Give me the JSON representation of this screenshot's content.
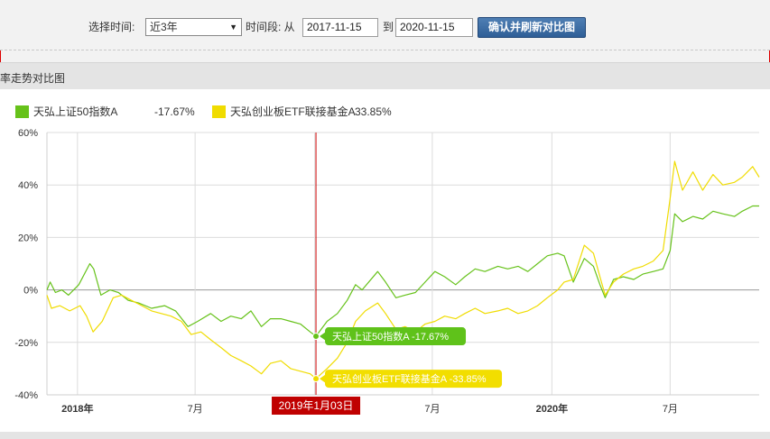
{
  "toolbar": {
    "period_label": "选择时间:",
    "period_value": "近3年",
    "range_label": "时间段: 从",
    "start_date": "2017-11-15",
    "to_label": "到",
    "end_date": "2020-11-15",
    "confirm_button": "确认并刷新对比图"
  },
  "section": {
    "title": "率走势对比图"
  },
  "colors": {
    "series_a": "#66c21a",
    "series_b": "#f0dc00",
    "crosshair": "#cc0000",
    "date_badge": "#c00000"
  },
  "legend": [
    {
      "name": "天弘上证50指数A",
      "value": "-17.67%"
    },
    {
      "name": "天弘创业板ETF联接基金A",
      "value": "-33.85%"
    }
  ],
  "tooltip": {
    "date": "2019年1月03日",
    "series_a": "天弘上证50指数A -17.67%",
    "series_b": "天弘创业板ETF联接基金A -33.85%"
  },
  "chart_data": {
    "type": "line",
    "title": "",
    "xlabel": "",
    "ylabel": "",
    "y_unit": "%",
    "ylim": [
      -40,
      60
    ],
    "y_ticks": [
      -40,
      -20,
      0,
      20,
      40,
      60
    ],
    "y_tick_labels": [
      "-40%",
      "-20%",
      "0%",
      "20%",
      "40%",
      "60%"
    ],
    "x_range": [
      "2017-11-15",
      "2020-11-15"
    ],
    "x_ticks": [
      {
        "date": "2018-01-01",
        "label": "2018年",
        "bold": true
      },
      {
        "date": "2018-07-01",
        "label": "7月",
        "bold": false
      },
      {
        "date": "2019-01-01",
        "label": "",
        "bold": false
      },
      {
        "date": "2019-07-01",
        "label": "7月",
        "bold": false
      },
      {
        "date": "2020-01-01",
        "label": "2020年",
        "bold": true
      },
      {
        "date": "2020-07-01",
        "label": "7月",
        "bold": false
      }
    ],
    "grid": true,
    "legend_position": "top-left",
    "crosshair_date": "2019-01-03",
    "series": [
      {
        "name": "天弘上证50指数A",
        "color": "#66c21a",
        "points": [
          [
            "2017-11-15",
            0
          ],
          [
            "2017-11-20",
            3
          ],
          [
            "2017-11-28",
            -1
          ],
          [
            "2017-12-08",
            0
          ],
          [
            "2017-12-18",
            -2
          ],
          [
            "2018-01-03",
            2
          ],
          [
            "2018-01-20",
            10
          ],
          [
            "2018-01-26",
            8
          ],
          [
            "2018-02-06",
            -2
          ],
          [
            "2018-02-20",
            0
          ],
          [
            "2018-03-05",
            -1
          ],
          [
            "2018-03-20",
            -4
          ],
          [
            "2018-04-05",
            -5
          ],
          [
            "2018-04-25",
            -7
          ],
          [
            "2018-05-15",
            -6
          ],
          [
            "2018-06-01",
            -8
          ],
          [
            "2018-06-20",
            -14
          ],
          [
            "2018-07-05",
            -12
          ],
          [
            "2018-07-25",
            -9
          ],
          [
            "2018-08-10",
            -12
          ],
          [
            "2018-08-25",
            -10
          ],
          [
            "2018-09-10",
            -11
          ],
          [
            "2018-09-25",
            -8
          ],
          [
            "2018-10-11",
            -14
          ],
          [
            "2018-10-25",
            -11
          ],
          [
            "2018-11-10",
            -11
          ],
          [
            "2018-11-25",
            -12
          ],
          [
            "2018-12-10",
            -13
          ],
          [
            "2018-12-25",
            -16
          ],
          [
            "2019-01-03",
            -17.67
          ],
          [
            "2019-01-20",
            -12
          ],
          [
            "2019-02-05",
            -9
          ],
          [
            "2019-02-20",
            -4
          ],
          [
            "2019-03-05",
            2
          ],
          [
            "2019-03-15",
            0
          ],
          [
            "2019-04-08",
            7
          ],
          [
            "2019-04-20",
            3
          ],
          [
            "2019-05-06",
            -3
          ],
          [
            "2019-05-20",
            -2
          ],
          [
            "2019-06-05",
            -1
          ],
          [
            "2019-06-20",
            3
          ],
          [
            "2019-07-05",
            7
          ],
          [
            "2019-07-20",
            5
          ],
          [
            "2019-08-06",
            2
          ],
          [
            "2019-08-20",
            5
          ],
          [
            "2019-09-05",
            8
          ],
          [
            "2019-09-20",
            7
          ],
          [
            "2019-10-10",
            9
          ],
          [
            "2019-10-25",
            8
          ],
          [
            "2019-11-10",
            9
          ],
          [
            "2019-11-25",
            7
          ],
          [
            "2019-12-10",
            10
          ],
          [
            "2019-12-25",
            13
          ],
          [
            "2020-01-10",
            14
          ],
          [
            "2020-01-20",
            13
          ],
          [
            "2020-02-03",
            3
          ],
          [
            "2020-02-20",
            12
          ],
          [
            "2020-03-05",
            9
          ],
          [
            "2020-03-15",
            2
          ],
          [
            "2020-03-23",
            -3
          ],
          [
            "2020-04-05",
            4
          ],
          [
            "2020-04-20",
            5
          ],
          [
            "2020-05-06",
            4
          ],
          [
            "2020-05-20",
            6
          ],
          [
            "2020-06-05",
            7
          ],
          [
            "2020-06-20",
            8
          ],
          [
            "2020-07-01",
            15
          ],
          [
            "2020-07-08",
            29
          ],
          [
            "2020-07-20",
            26
          ],
          [
            "2020-08-05",
            28
          ],
          [
            "2020-08-20",
            27
          ],
          [
            "2020-09-05",
            30
          ],
          [
            "2020-09-20",
            29
          ],
          [
            "2020-10-08",
            28
          ],
          [
            "2020-10-20",
            30
          ],
          [
            "2020-11-05",
            32
          ],
          [
            "2020-11-15",
            32
          ]
        ]
      },
      {
        "name": "天弘创业板ETF联接基金A",
        "color": "#f0dc00",
        "points": [
          [
            "2017-11-15",
            -2
          ],
          [
            "2017-11-22",
            -7
          ],
          [
            "2017-12-05",
            -6
          ],
          [
            "2017-12-20",
            -8
          ],
          [
            "2018-01-05",
            -6
          ],
          [
            "2018-01-15",
            -10
          ],
          [
            "2018-01-25",
            -16
          ],
          [
            "2018-02-08",
            -12
          ],
          [
            "2018-02-25",
            -3
          ],
          [
            "2018-03-10",
            -2
          ],
          [
            "2018-03-25",
            -4
          ],
          [
            "2018-04-10",
            -6
          ],
          [
            "2018-04-25",
            -8
          ],
          [
            "2018-05-10",
            -9
          ],
          [
            "2018-05-25",
            -10
          ],
          [
            "2018-06-10",
            -12
          ],
          [
            "2018-06-25",
            -17
          ],
          [
            "2018-07-10",
            -16
          ],
          [
            "2018-07-25",
            -19
          ],
          [
            "2018-08-10",
            -22
          ],
          [
            "2018-08-25",
            -25
          ],
          [
            "2018-09-10",
            -27
          ],
          [
            "2018-09-25",
            -29
          ],
          [
            "2018-10-11",
            -32
          ],
          [
            "2018-10-25",
            -28
          ],
          [
            "2018-11-10",
            -27
          ],
          [
            "2018-11-25",
            -30
          ],
          [
            "2018-12-10",
            -31
          ],
          [
            "2018-12-25",
            -32
          ],
          [
            "2019-01-03",
            -33.85
          ],
          [
            "2019-01-20",
            -30
          ],
          [
            "2019-02-05",
            -26
          ],
          [
            "2019-02-20",
            -20
          ],
          [
            "2019-03-05",
            -12
          ],
          [
            "2019-03-20",
            -8
          ],
          [
            "2019-04-08",
            -5
          ],
          [
            "2019-04-20",
            -9
          ],
          [
            "2019-05-06",
            -15
          ],
          [
            "2019-05-20",
            -14
          ],
          [
            "2019-06-05",
            -16
          ],
          [
            "2019-06-20",
            -13
          ],
          [
            "2019-07-05",
            -12
          ],
          [
            "2019-07-20",
            -10
          ],
          [
            "2019-08-06",
            -11
          ],
          [
            "2019-08-20",
            -9
          ],
          [
            "2019-09-05",
            -7
          ],
          [
            "2019-09-20",
            -9
          ],
          [
            "2019-10-10",
            -8
          ],
          [
            "2019-10-25",
            -7
          ],
          [
            "2019-11-10",
            -9
          ],
          [
            "2019-11-25",
            -8
          ],
          [
            "2019-12-10",
            -6
          ],
          [
            "2019-12-25",
            -3
          ],
          [
            "2020-01-10",
            0
          ],
          [
            "2020-01-20",
            3
          ],
          [
            "2020-02-03",
            4
          ],
          [
            "2020-02-20",
            17
          ],
          [
            "2020-03-05",
            14
          ],
          [
            "2020-03-15",
            5
          ],
          [
            "2020-03-23",
            -2
          ],
          [
            "2020-04-05",
            3
          ],
          [
            "2020-04-20",
            6
          ],
          [
            "2020-05-06",
            8
          ],
          [
            "2020-05-20",
            9
          ],
          [
            "2020-06-05",
            11
          ],
          [
            "2020-06-20",
            15
          ],
          [
            "2020-07-01",
            35
          ],
          [
            "2020-07-08",
            49
          ],
          [
            "2020-07-20",
            38
          ],
          [
            "2020-08-05",
            45
          ],
          [
            "2020-08-20",
            38
          ],
          [
            "2020-09-05",
            44
          ],
          [
            "2020-09-20",
            40
          ],
          [
            "2020-10-08",
            41
          ],
          [
            "2020-10-20",
            43
          ],
          [
            "2020-11-05",
            47
          ],
          [
            "2020-11-15",
            43
          ]
        ]
      }
    ]
  }
}
